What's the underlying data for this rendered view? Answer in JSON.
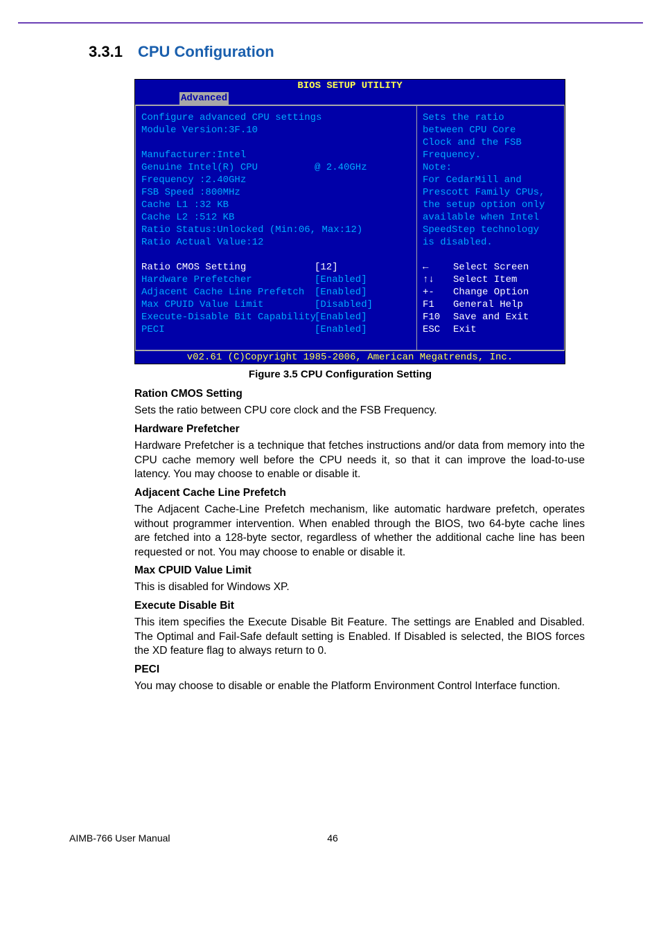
{
  "section_number": "3.3.1",
  "section_title": "CPU Configuration",
  "bios": {
    "title": "BIOS SETUP UTILITY",
    "active_tab": "Advanced",
    "header1": "Configure advanced CPU settings",
    "header2": "Module Version:3F.10",
    "info": {
      "l0": "Manufacturer:Intel",
      "l1a": "Genuine Intel(R) CPU",
      "l1b": "@ 2.40GHz",
      "l2": "Frequency   :2.40GHz",
      "l3": "FSB Speed   :800MHz",
      "l4": "Cache L1    :32 KB",
      "l5": "Cache L2    :512 KB",
      "l6": "Ratio Status:Unlocked (Min:06, Max:12)",
      "l7": "Ratio Actual Value:12"
    },
    "settings": [
      {
        "label": "Ratio CMOS Setting",
        "value": "[12]"
      },
      {
        "label": "Hardware Prefetcher",
        "value": "[Enabled]"
      },
      {
        "label": "Adjacent Cache Line Prefetch",
        "value": "[Enabled]"
      },
      {
        "label": "Max CPUID Value Limit",
        "value": "[Disabled]"
      },
      {
        "label": "Execute-Disable Bit Capability",
        "value": "[Enabled]"
      },
      {
        "label": "PECI",
        "value": "[Enabled]"
      }
    ],
    "help": {
      "l0": "Sets the ratio",
      "l1": "between CPU Core",
      "l2": "Clock and the FSB",
      "l3": "Frequency.",
      "l4": "Note:",
      "l5": "For CedarMill and",
      "l6": "Prescott Family CPUs,",
      "l7": "the setup option only",
      "l8": "available when Intel",
      "l9": "SpeedStep technology",
      "l10": "is disabled."
    },
    "keys": [
      {
        "k": "←",
        "t": "Select Screen"
      },
      {
        "k": "↑↓",
        "t": "Select Item"
      },
      {
        "k": "+-",
        "t": "Change Option"
      },
      {
        "k": "F1",
        "t": "General Help"
      },
      {
        "k": "F10",
        "t": "Save and Exit"
      },
      {
        "k": "ESC",
        "t": "Exit"
      }
    ],
    "copyright": "v02.61 (C)Copyright 1985-2006, American Megatrends, Inc."
  },
  "figure_caption": "Figure 3.5 CPU Configuration Setting",
  "body": {
    "h1": "Ration CMOS Setting",
    "p1": "Sets the ratio between CPU core clock and the FSB Frequency.",
    "h2": "Hardware Prefetcher",
    "p2": "Hardware Prefetcher is a technique that fetches instructions and/or data from memory into the CPU cache memory well before the CPU needs it, so that it can improve the load-to-use latency. You may choose to enable or disable it.",
    "h3": "Adjacent Cache Line Prefetch",
    "p3": "The Adjacent Cache-Line Prefetch mechanism, like automatic hardware prefetch, operates without programmer intervention. When enabled through the BIOS, two 64-byte cache lines are fetched into a 128-byte sector, regardless of whether the additional cache line has been requested or not. You may choose to enable or disable it.",
    "h4": "Max CPUID Value Limit",
    "p4": "This is disabled for Windows XP.",
    "h5": "Execute Disable Bit",
    "p5": "This item specifies the Execute Disable Bit Feature. The settings are Enabled and Disabled. The Optimal and Fail-Safe default setting is Enabled. If Disabled is selected, the BIOS forces the XD feature flag to always return to 0.",
    "h6": "PECI",
    "p6": "You may choose to disable or enable the Platform Environment Control Interface function."
  },
  "footer_left": "AIMB-766 User Manual",
  "footer_page": "46"
}
